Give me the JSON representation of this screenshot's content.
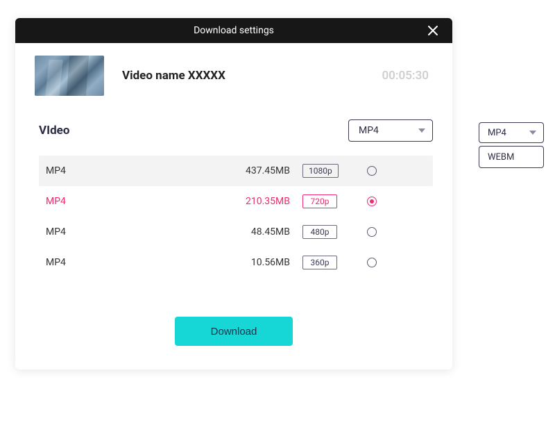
{
  "modal": {
    "title": "Download settings"
  },
  "video": {
    "name": "Video name XXXXX",
    "duration": "00:05:30"
  },
  "section": {
    "label": "VIdeo",
    "format_select": {
      "value": "MP4",
      "options": [
        "MP4",
        "WEBM"
      ]
    }
  },
  "rows": [
    {
      "format": "MP4",
      "size": "437.45MB",
      "resolution": "1080p",
      "selected": false,
      "hover": true
    },
    {
      "format": "MP4",
      "size": "210.35MB",
      "resolution": "720p",
      "selected": true,
      "hover": false
    },
    {
      "format": "MP4",
      "size": "48.45MB",
      "resolution": "480p",
      "selected": false,
      "hover": false
    },
    {
      "format": "MP4",
      "size": "10.56MB",
      "resolution": "360p",
      "selected": false,
      "hover": false
    }
  ],
  "download_button": "Download",
  "external_dropdown": {
    "value": "MP4",
    "options": [
      "WEBM"
    ]
  },
  "colors": {
    "accent": "#ef2a72",
    "primary_button": "#17d6d6",
    "header_bg": "#171717"
  }
}
